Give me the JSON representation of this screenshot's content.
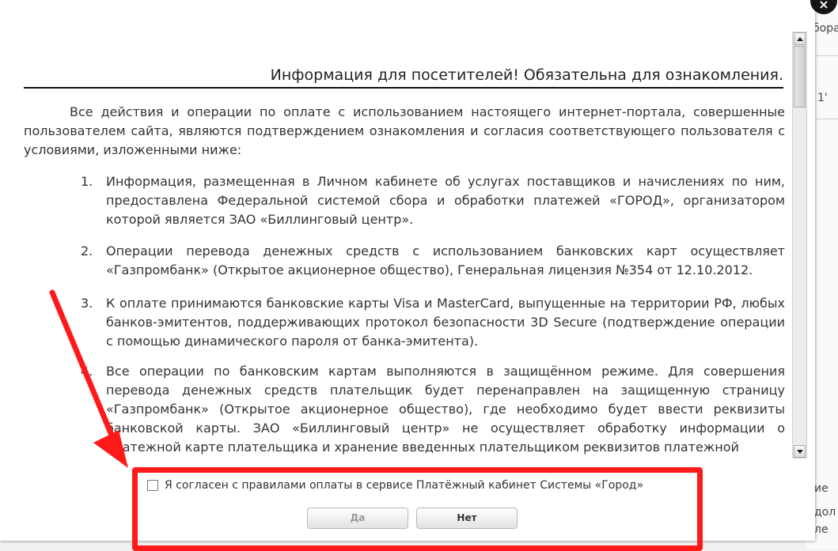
{
  "background": {
    "fragments": [
      "бора",
      "1'",
      "ие",
      "дол",
      "ле"
    ]
  },
  "modal": {
    "close_glyph": "×",
    "title": "Информация для посетителей! Обязательна для ознакомления.",
    "intro": "Все действия и операции по оплате  с использованием настоящего интернет-портала, совершенные пользователем       сайта, являются подтверждением ознакомления и согласия соответствующего пользователя с условиями, изложенными ниже:",
    "items": [
      {
        "num": "1.",
        "text": "Информация, размещенная в Личном кабинете об услугах поставщиков и начислениях по ним, предоставлена Федеральной системой сбора и обработки платежей «ГОРОД», организатором которой является ЗАО «Биллинговый центр»."
      },
      {
        "num": "2.",
        "text": "Операции перевода денежных средств с использованием банковских карт осуществляет «Газпромбанк» (Открытое акционерное общество), Генеральная лицензия №354 от 12.10.2012."
      },
      {
        "num": "3.",
        "text": "К оплате принимаются банковские карты Visa и  MasterCard, выпущенные на территории РФ, любых банков-эмитентов, поддерживающих протокол безопасности 3D Secure (подтверждение операции  с помощью динамического пароля от банка-эмитента)."
      },
      {
        "num": "4.",
        "text": "Все операции по банковским картам выполняются в защищённом режиме. Для совершения перевода денежных средств плательщик будет перенаправлен на защищенную страницу «Газпромбанк» (Открытое акционерное общество), где необходимо будет ввести реквизиты банковской  карты.   ЗАО «Биллинговый центр» не осуществляет обработку информации о платежной карте плательщика и хранение введенных плательщиком реквизитов платежной"
      }
    ],
    "agree_label": "Я согласен с правилами оплаты в сервисе Платёжный кабинет Системы «Город»",
    "yes_label": "Да",
    "no_label": "Нет"
  },
  "colors": {
    "annotation_red": "#ff1a1a"
  }
}
